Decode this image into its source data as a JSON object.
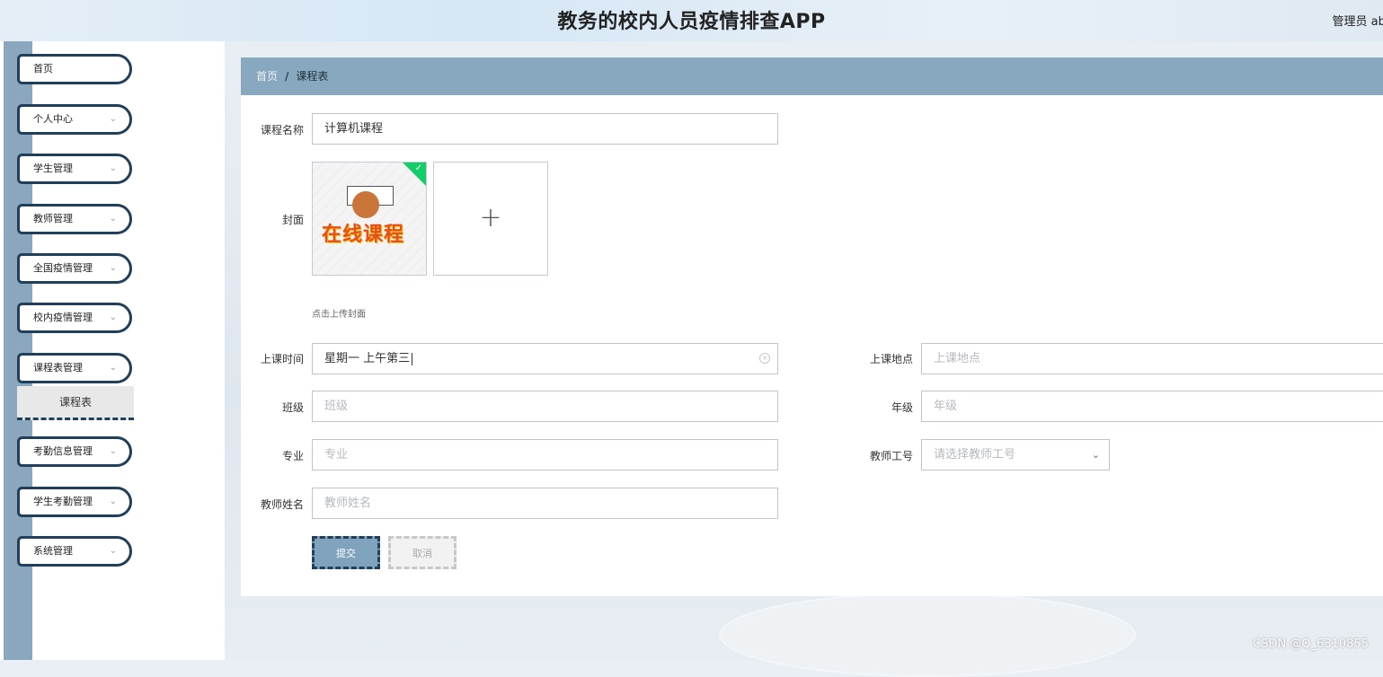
{
  "header": {
    "title": "教务的校内人员疫情排查APP",
    "user": "管理员 abc"
  },
  "sidebar": {
    "items": [
      {
        "label": "首页",
        "has_arrow": false
      },
      {
        "label": "个人中心",
        "has_arrow": true
      },
      {
        "label": "学生管理",
        "has_arrow": true
      },
      {
        "label": "教师管理",
        "has_arrow": true
      },
      {
        "label": "全国疫情管理",
        "has_arrow": true
      },
      {
        "label": "校内疫情管理",
        "has_arrow": true
      },
      {
        "label": "课程表管理",
        "has_arrow": true
      },
      {
        "label": "考勤信息管理",
        "has_arrow": true
      },
      {
        "label": "学生考勤管理",
        "has_arrow": true
      },
      {
        "label": "系统管理",
        "has_arrow": true
      }
    ],
    "subitem": {
      "label": "课程表"
    }
  },
  "breadcrumb": {
    "home": "首页",
    "separator": "/",
    "current": "课程表"
  },
  "form": {
    "course_name": {
      "label": "课程名称",
      "value": "计算机课程"
    },
    "cover": {
      "label": "封面",
      "image_text": "在线课程",
      "tip": "点击上传封面",
      "add_symbol": "+"
    },
    "class_time": {
      "label": "上课时间",
      "value": "星期一 上午第三"
    },
    "location": {
      "label": "上课地点",
      "placeholder": "上课地点"
    },
    "class": {
      "label": "班级",
      "placeholder": "班级"
    },
    "grade": {
      "label": "年级",
      "placeholder": "年级"
    },
    "major": {
      "label": "专业",
      "placeholder": "专业"
    },
    "teacher_id": {
      "label": "教师工号",
      "placeholder": "请选择教师工号"
    },
    "teacher_name": {
      "label": "教师姓名",
      "placeholder": "教师姓名"
    },
    "submit_label": "提交",
    "cancel_label": "取消"
  },
  "watermark": "CSDN @Q_6310855",
  "colors": {
    "accent": "#87a8be",
    "dark_border": "#1f3f5a",
    "success": "#13ce66"
  }
}
